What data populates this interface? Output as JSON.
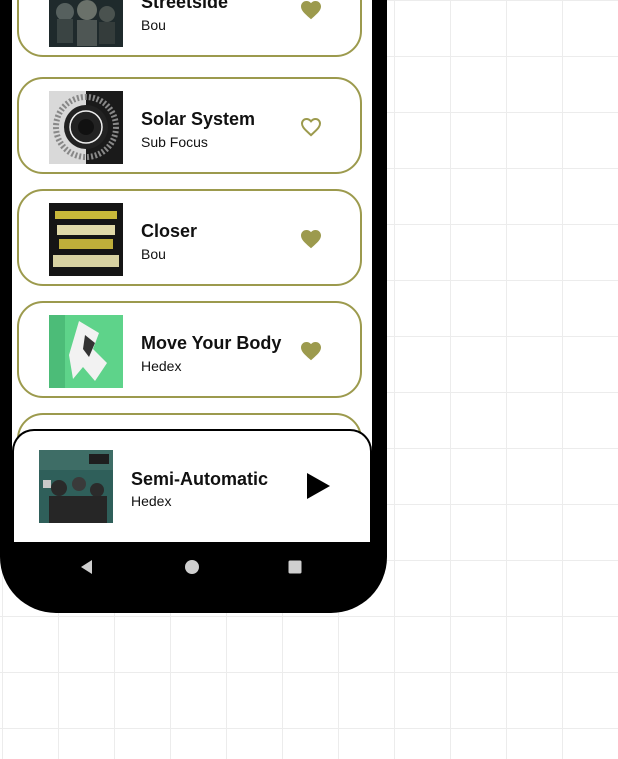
{
  "colors": {
    "accent": "#9c9a4d",
    "card_border": "#9c9a4d",
    "phone_frame": "#000000"
  },
  "songs": [
    {
      "title": "Streetside",
      "artist": "Bou",
      "liked": true,
      "heart_icon": "heart-filled-icon"
    },
    {
      "title": "Solar System",
      "artist": "Sub Focus",
      "liked": false,
      "heart_icon": "heart-outline-icon"
    },
    {
      "title": "Closer",
      "artist": "Bou",
      "liked": true,
      "heart_icon": "heart-filled-icon"
    },
    {
      "title": "Move Your Body",
      "artist": "Hedex",
      "liked": true,
      "heart_icon": "heart-filled-icon"
    }
  ],
  "now_playing": {
    "title": "Semi-Automatic",
    "artist": "Hedex",
    "control_icon": "play-icon"
  },
  "nav": {
    "back_icon": "back-triangle-icon",
    "home_icon": "home-circle-icon",
    "recents_icon": "recents-square-icon"
  }
}
